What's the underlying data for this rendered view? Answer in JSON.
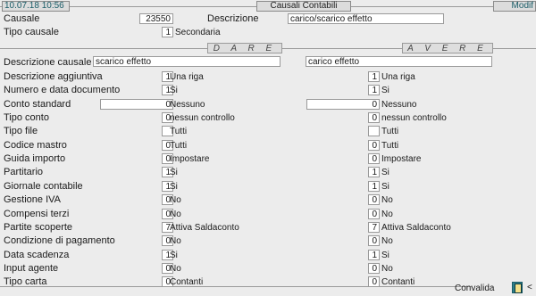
{
  "header": {
    "datetime": "10.07.18 10:56",
    "title": "Causali Contabili",
    "mode": "Modif"
  },
  "top": {
    "causale_label": "Causale",
    "causale_value": "23550",
    "descrizione_label": "Descrizione",
    "descrizione_value": "carico/scarico effetto",
    "tipo_label": "Tipo causale",
    "tipo_value": "1",
    "tipo_desc": "Secondaria"
  },
  "sections": {
    "dare": "D A R E",
    "avere": "A V E R E"
  },
  "desc_row": {
    "label": "Descrizione causale",
    "dare": "scarico effetto",
    "avere": "carico effetto"
  },
  "rows": [
    {
      "label": "Descrizione aggiuntiva",
      "dare_val": "1",
      "dare_desc": "Una riga",
      "avere_val": "1",
      "avere_desc": "Una riga"
    },
    {
      "label": "Numero e data documento",
      "dare_val": "1",
      "dare_desc": "Si",
      "avere_val": "1",
      "avere_desc": "Si"
    },
    {
      "label": "Conto standard",
      "dare_val": "0",
      "dare_desc": "Nessuno",
      "avere_val": "0",
      "avere_desc": "Nessuno"
    },
    {
      "label": "Tipo conto",
      "dare_val": "0",
      "dare_desc": "nessun controllo",
      "avere_val": "0",
      "avere_desc": "nessun controllo"
    },
    {
      "label": "Tipo file",
      "dare_val": "",
      "dare_desc": "Tutti",
      "avere_val": "",
      "avere_desc": "Tutti"
    },
    {
      "label": "Codice mastro",
      "dare_val": "0",
      "dare_desc": "Tutti",
      "avere_val": "0",
      "avere_desc": "Tutti"
    },
    {
      "label": "Guida importo",
      "dare_val": "0",
      "dare_desc": "Impostare",
      "avere_val": "0",
      "avere_desc": "Impostare"
    },
    {
      "label": "Partitario",
      "dare_val": "1",
      "dare_desc": "Si",
      "avere_val": "1",
      "avere_desc": "Si"
    },
    {
      "label": "Giornale contabile",
      "dare_val": "1",
      "dare_desc": "Si",
      "avere_val": "1",
      "avere_desc": "Si"
    },
    {
      "label": "Gestione IVA",
      "dare_val": "0",
      "dare_desc": "No",
      "avere_val": "0",
      "avere_desc": "No"
    },
    {
      "label": "Compensi terzi",
      "dare_val": "0",
      "dare_desc": "No",
      "avere_val": "0",
      "avere_desc": "No"
    },
    {
      "label": "Partite scoperte",
      "dare_val": "7",
      "dare_desc": "Attiva Saldaconto",
      "avere_val": "7",
      "avere_desc": "Attiva Saldaconto"
    },
    {
      "label": "Condizione di pagamento",
      "dare_val": "0",
      "dare_desc": "No",
      "avere_val": "0",
      "avere_desc": "No"
    },
    {
      "label": "Data scadenza",
      "dare_val": "1",
      "dare_desc": "Si",
      "avere_val": "1",
      "avere_desc": "Si"
    },
    {
      "label": "Input agente",
      "dare_val": "0",
      "dare_desc": "No",
      "avere_val": "0",
      "avere_desc": "No"
    },
    {
      "label": "Tipo carta",
      "dare_val": "0",
      "dare_desc": "Contanti",
      "avere_val": "0",
      "avere_desc": "Contanti"
    }
  ],
  "footer": {
    "convalida": "Convalida",
    "arrow": "<"
  },
  "colors": {
    "teal": "#1a5d68",
    "background": "#ececec",
    "field": "#ffffff"
  }
}
